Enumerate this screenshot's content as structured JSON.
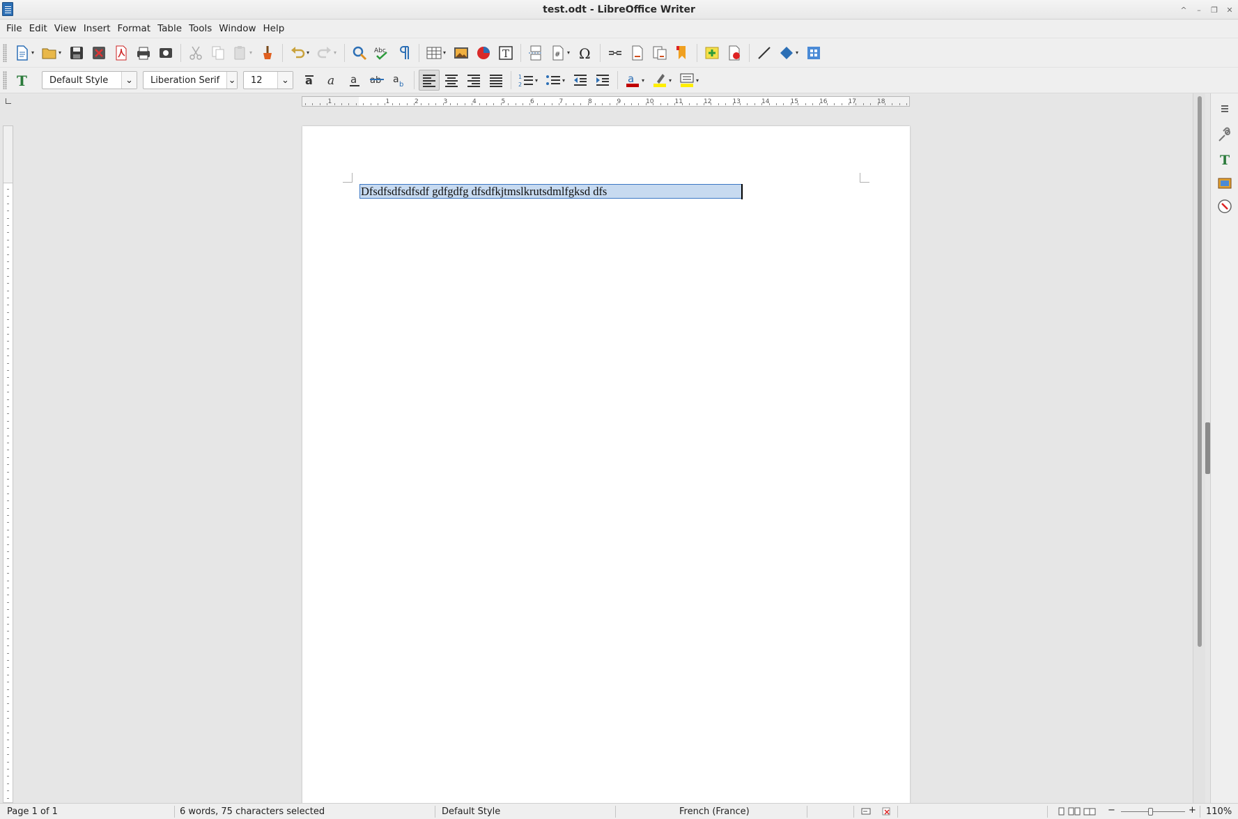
{
  "window": {
    "title": "test.odt - LibreOffice Writer",
    "controls": [
      "^",
      "–",
      "❐",
      "✕"
    ]
  },
  "menu": [
    "File",
    "Edit",
    "View",
    "Insert",
    "Format",
    "Table",
    "Tools",
    "Window",
    "Help"
  ],
  "formatting": {
    "paragraph_style": "Default Style",
    "font_name": "Liberation Serif",
    "font_size": "12"
  },
  "toolbar_icons": {
    "standard": [
      "new-icon",
      "open-icon",
      "save-icon",
      "save-as-icon",
      "export-pdf-icon",
      "print-icon",
      "print-preview-icon",
      "cut-icon",
      "copy-icon",
      "paste-icon",
      "clone-formatting-icon",
      "undo-icon",
      "redo-icon",
      "find-replace-icon",
      "spelling-icon",
      "formatting-marks-icon",
      "insert-table-icon",
      "insert-image-icon",
      "insert-chart-icon",
      "insert-textbox-icon",
      "page-break-icon",
      "field-icon",
      "special-character-icon",
      "hyperlink-icon",
      "footnote-icon",
      "endnote-icon",
      "bookmark-icon",
      "comment-icon",
      "track-changes-icon",
      "line-icon",
      "shapes-icon",
      "draw-functions-icon"
    ],
    "formatting": [
      "styles-icon",
      "bold-icon",
      "italic-icon",
      "underline-icon",
      "strikethrough-icon",
      "shadow-icon",
      "align-left-icon",
      "align-center-icon",
      "align-right-icon",
      "justify-icon",
      "numbered-list-icon",
      "bullet-list-icon",
      "decrease-indent-icon",
      "increase-indent-icon",
      "font-color-icon",
      "highlight-icon",
      "paragraph-background-icon"
    ]
  },
  "ruler": {
    "labels": [
      "1",
      "1",
      "2",
      "3",
      "4",
      "5",
      "6",
      "7",
      "8",
      "9",
      "10",
      "11",
      "12",
      "13",
      "14",
      "15",
      "16",
      "17",
      "18"
    ]
  },
  "document": {
    "text": "Dfsdfsdfsdfsdf gdfgdfg dfsdfkjtmslkrutsdmlfgksd dfs"
  },
  "colors": {
    "selection": "#c7daf0",
    "selection_border": "#3a76c4",
    "font_color": "#c00000",
    "highlight": "#ffee00"
  },
  "status": {
    "page": "Page 1 of 1",
    "word_count": "6 words, 75 characters selected",
    "page_style": "Default Style",
    "language": "French (France)",
    "zoom": "110%",
    "zoom_level": 1.1
  }
}
